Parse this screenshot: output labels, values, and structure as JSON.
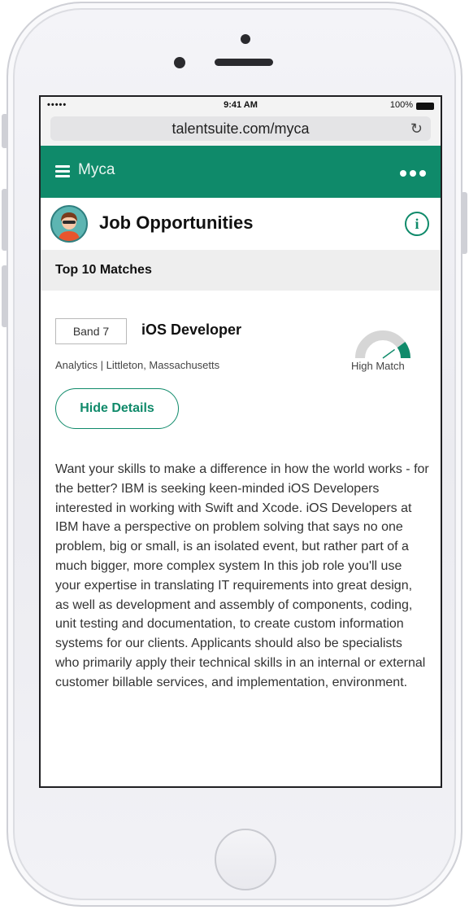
{
  "status_bar": {
    "signal": "••••• ",
    "time": "9:41 AM",
    "battery": "100%"
  },
  "browser": {
    "url": "talentsuite.com/myca",
    "reload_icon": "reload-icon"
  },
  "app_header": {
    "title": "Myca",
    "menu_icon": "hamburger-icon",
    "more_icon": "more-dots-icon",
    "accent_color": "#0f8a6a"
  },
  "page": {
    "title": "Job Opportunities",
    "info_icon": "info-icon",
    "section_title": "Top 10 Matches"
  },
  "job": {
    "band": "Band 7",
    "title": "iOS Developer",
    "department": "Analytics",
    "separator": "|",
    "location": "Littleton, Massachusetts",
    "match_label": "High Match",
    "match_level": 0.8,
    "toggle_label": "Hide Details",
    "description": "Want your skills to make a difference in how the world works - for the better? IBM is seeking keen-minded iOS Developers interested in working with Swift and Xcode. iOS Developers at IBM have a perspective on problem solving that says no one problem, big or small, is an isolated event, but rather part of a much bigger, more complex system In this job role you'll use your expertise in translating IT requirements into great design, as well as development and assembly of components, coding, unit testing and documentation, to create custom information systems for our clients. Applicants should also be specialists who primarily apply their technical skills in an internal or external customer billable services, and implementation, environment."
  }
}
